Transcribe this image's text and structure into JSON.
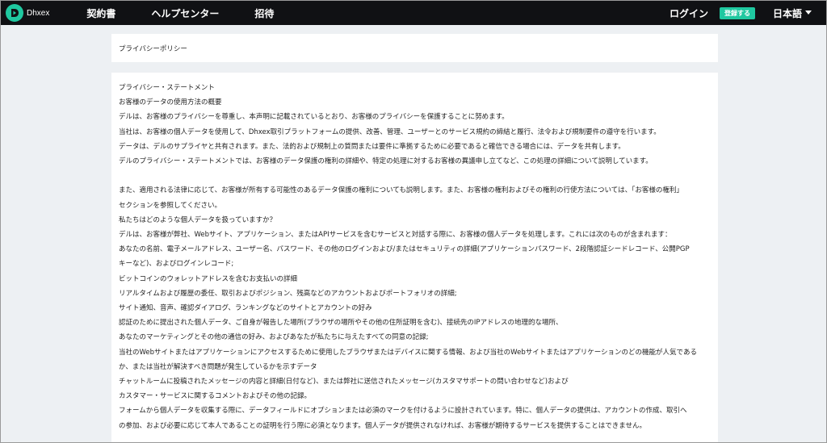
{
  "header": {
    "logo_text": "Dhxex",
    "nav": [
      {
        "label": "契約書"
      },
      {
        "label": "ヘルプセンター"
      },
      {
        "label": "招待"
      }
    ],
    "login_label": "ログイン",
    "register_label": "登録する",
    "language_label": "日本語"
  },
  "page": {
    "title": "プライバシーポリシー",
    "lines": [
      "プライバシー・ステートメント",
      "お客様のデータの使用方法の概要",
      "デルは、お客様のプライバシーを尊重し、本声明に記載されているとおり、お客様のプライバシーを保護することに努めます。",
      "当社は、お客様の個人データを使用して、Dhxex取引プラットフォームの提供、改善、管理、ユーザーとのサービス規約の締結と履行、法令および規制要件の遵守を行います。",
      "データは、デルのサプライヤと共有されます。また、法的および規制上の質問または要件に準拠するために必要であると確信できる場合には、データを共有します。",
      "デルのプライバシー・ステートメントでは、お客様のデータ保護の権利の詳細や、特定の処理に対するお客様の異議申し立てなど、この処理の詳細について説明しています。",
      "",
      "また、適用される法律に応じて、お客様が所有する可能性のあるデータ保護の権利についても説明します。また、お客様の権利およびその権利の行使方法については、「お客様の権利」",
      "セクションを参照してください。",
      "私たちはどのような個人データを扱っていますか？",
      "デルは、お客様が弊社、Webサイト、アプリケーション、またはAPIサービスを含むサービスと対話する際に、お客様の個人データを処理します。これには次のものが含まれます：",
      "あなたの名前、電子メールアドレス、ユーザー名、パスワード、その他のログインおよび/またはセキュリティの詳細(アプリケーションパスワード、2段階認証シードレコード、公開PGP",
      "キーなど)、およびログインレコード;",
      "ビットコインのウォレットアドレスを含むお支払いの詳細",
      "リアルタイムおよび履歴の委任、取引およびポジション、残高などのアカウントおよびポートフォリオの詳細;",
      "サイト通知、音声、確認ダイアログ、ランキングなどのサイトとアカウントの好み",
      "認証のために提出された個人データ、ご自身が報告した場所(ブラウザの場所やその他の住所証明を含む)、接続先のIPアドレスの地理的な場所、",
      "あなたのマーケティングとその他の通信の好み、およびあなたが私たちに与えたすべての同意の記録;",
      "当社のWebサイトまたはアプリケーションにアクセスするために使用したブラウザまたはデバイスに関する情報、および当社のWebサイトまたはアプリケーションのどの機能が人気である",
      "か、または当社が解決すべき問題が発生しているかを示すデータ",
      "チャットルームに投稿されたメッセージの内容と詳細(日付など)、または弊社に送信されたメッセージ(カスタマサポートの問い合わせなど)および",
      "カスタマー・サービスに関するコメントおよびその他の記録。",
      "フォームから個人データを収集する際に、データフィールドにオプションまたは必須のマークを付けるように設計されています。特に、個人データの提供は、アカウントの作成、取引へ",
      "の参加、および必要に応じて本人であることの証明を行う際に必須となります。個人データが提供されなければ、お客様が期待するサービスを提供することはできません。"
    ]
  },
  "colors": {
    "topbar": "#101114",
    "accent": "#1fc8a0",
    "page_bg": "#edf0f3",
    "card_bg": "#ffffff"
  }
}
